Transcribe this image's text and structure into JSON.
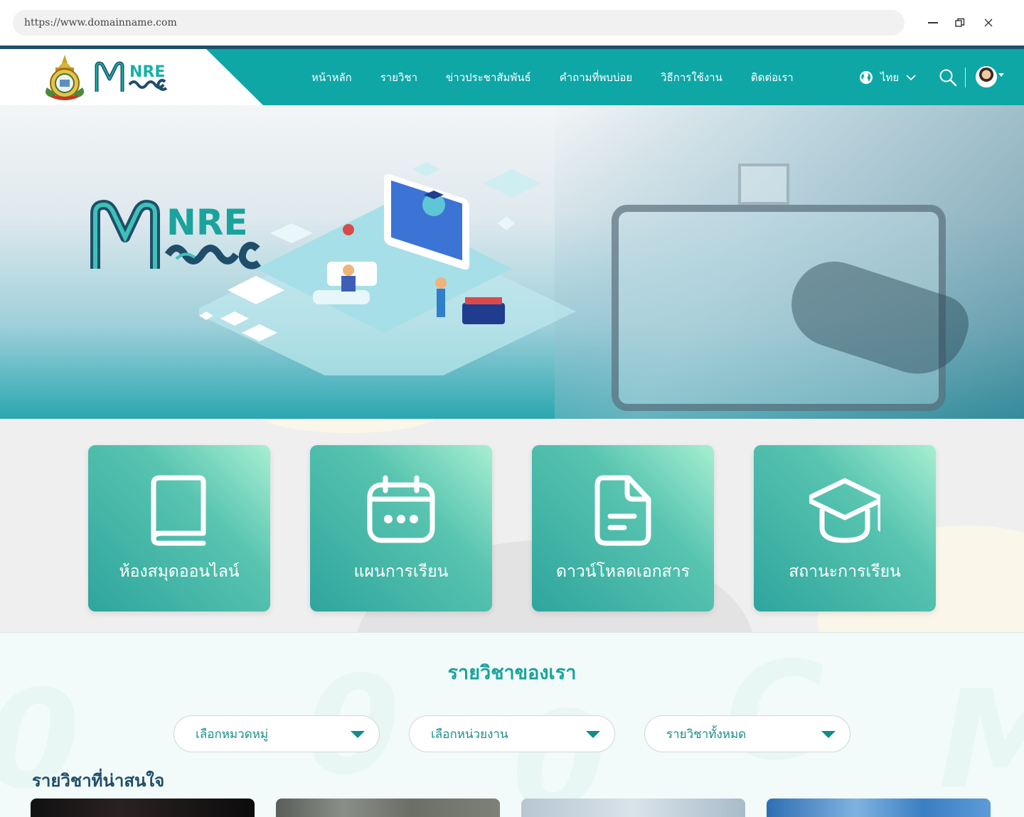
{
  "browser": {
    "url": "https://www.domainname.com"
  },
  "nav": {
    "items": [
      {
        "label": "หน้าหลัก"
      },
      {
        "label": "รายวิชา"
      },
      {
        "label": "ข่าวประชาสัมพันธ์"
      },
      {
        "label": "คำถามที่พบบ่อย"
      },
      {
        "label": "วิธีการใช้งาน"
      },
      {
        "label": "ติดต่อเรา"
      }
    ],
    "language": "ไทย",
    "logo_text": "NRE"
  },
  "hero": {
    "logo_text": "NRE"
  },
  "services": [
    {
      "label": "ห้องสมุดออนไลน์",
      "icon": "book-icon"
    },
    {
      "label": "แผนการเรียน",
      "icon": "calendar-icon"
    },
    {
      "label": "ดาวน์โหลดเอกสาร",
      "icon": "document-icon"
    },
    {
      "label": "สถานะการเรียน",
      "icon": "graduation-cap-icon"
    }
  ],
  "courses": {
    "title": "รายวิชาของเรา",
    "filters": [
      {
        "value": "เลือกหมวดหมู่"
      },
      {
        "value": "เลือกหน่วยงาน"
      },
      {
        "value": "รายวิชาทั้งหมด"
      }
    ],
    "interesting_title": "รายวิชาที่น่าสนใจ"
  },
  "colors": {
    "primary": "#0fa6a6",
    "dark": "#1f4e6b",
    "card_light": "#a7efd1",
    "card_dark": "#2fa59d"
  }
}
